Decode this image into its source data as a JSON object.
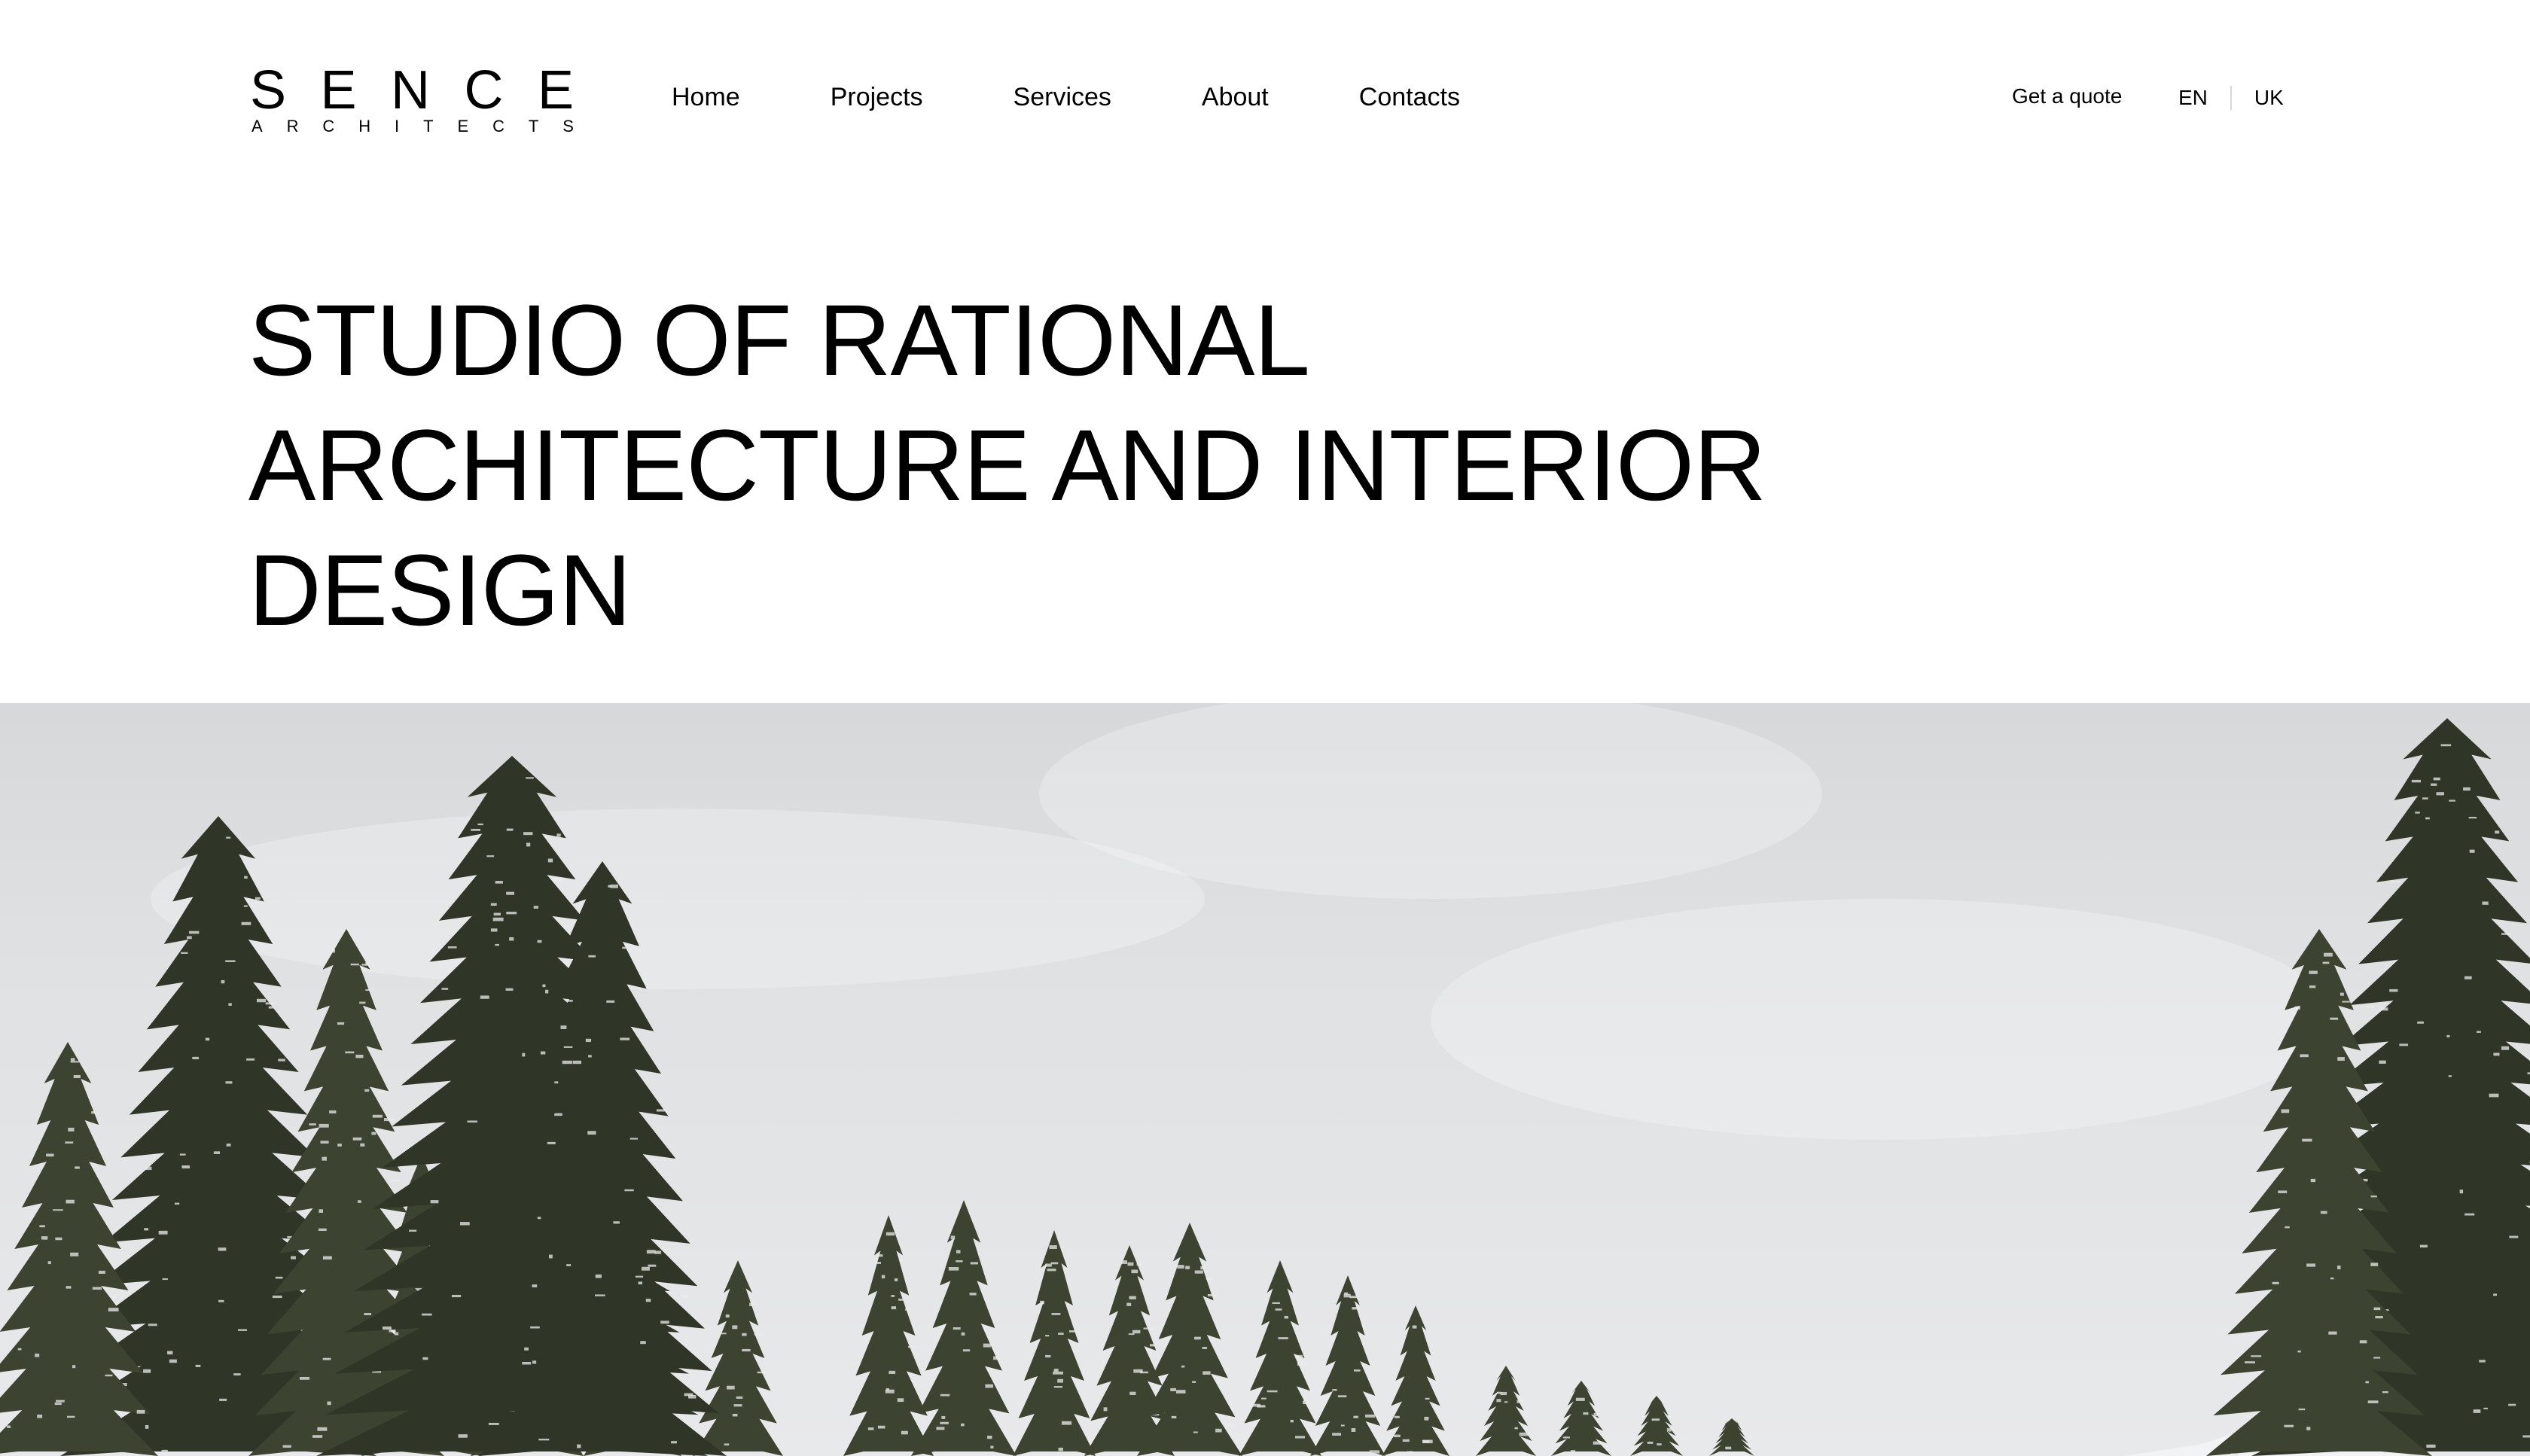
{
  "brand": {
    "name": "SENCE",
    "tagline": "ARCHITECTS"
  },
  "nav": {
    "items": [
      {
        "label": "Home"
      },
      {
        "label": "Projects"
      },
      {
        "label": "Services"
      },
      {
        "label": "About"
      },
      {
        "label": "Contacts"
      }
    ]
  },
  "header_actions": {
    "quote_label": "Get a quote",
    "languages": [
      "EN",
      "UK"
    ]
  },
  "hero": {
    "headline_lines": [
      "STUDIO OF RATIONAL",
      "ARCHITECTURE AND INTERIOR",
      "DESIGN"
    ],
    "image_alt": "snowy-pine-forest-photo"
  },
  "colors": {
    "background": "#ffffff",
    "text": "#000000",
    "sky": "#dfe1e3",
    "tree_dark": "#2f3527",
    "tree_mid": "#3c4330",
    "snow": "#e9ebe9"
  }
}
